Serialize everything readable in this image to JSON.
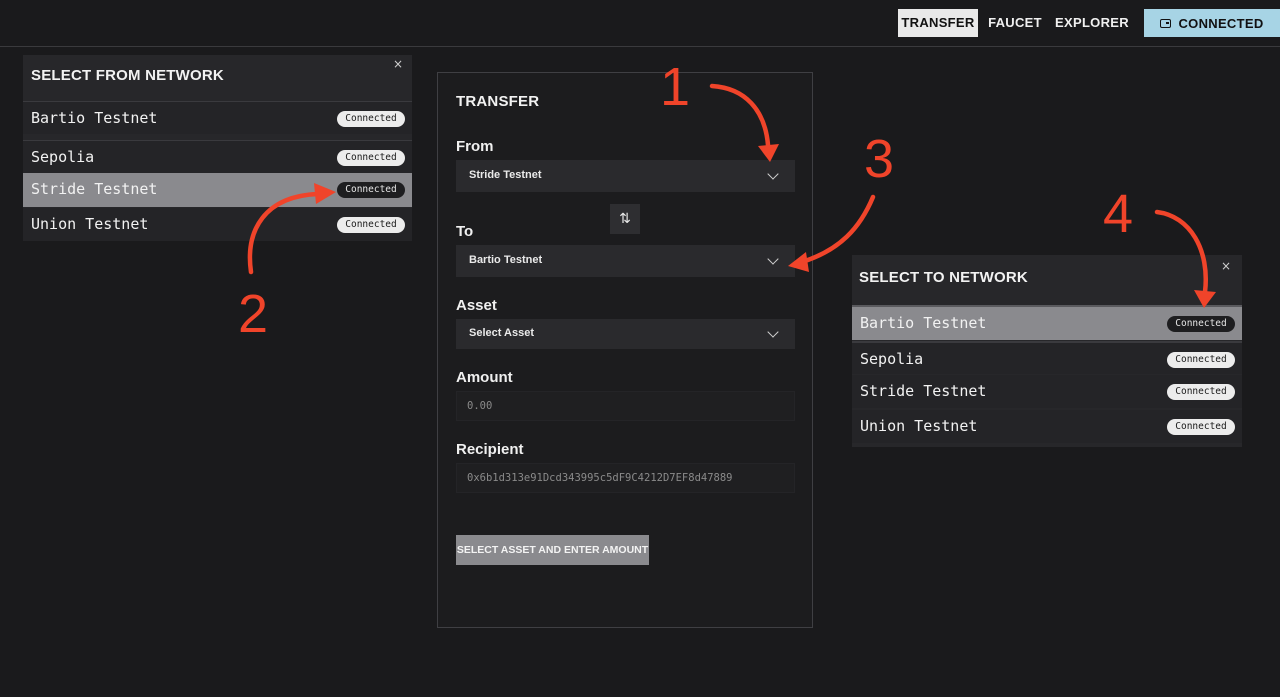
{
  "nav": {
    "transfer": "TRANSFER",
    "faucet": "FAUCET",
    "explorer": "EXPLORER",
    "connected": "CONNECTED"
  },
  "from_panel": {
    "title": "SELECT FROM NETWORK",
    "close": "×",
    "networks": [
      {
        "name": "Bartio Testnet",
        "status": "Connected"
      },
      {
        "name": "Sepolia",
        "status": "Connected"
      },
      {
        "name": "Stride Testnet",
        "status": "Connected"
      },
      {
        "name": "Union Testnet",
        "status": "Connected"
      }
    ]
  },
  "to_panel": {
    "title": "SELECT TO NETWORK",
    "close": "×",
    "networks": [
      {
        "name": "Bartio Testnet",
        "status": "Connected"
      },
      {
        "name": "Sepolia",
        "status": "Connected"
      },
      {
        "name": "Stride Testnet",
        "status": "Connected"
      },
      {
        "name": "Union Testnet",
        "status": "Connected"
      }
    ]
  },
  "transfer": {
    "title": "TRANSFER",
    "from_label": "From",
    "from_value": "Stride Testnet",
    "swap_icon": "⇅",
    "to_label": "To",
    "to_value": "Bartio Testnet",
    "asset_label": "Asset",
    "asset_value": "Select Asset",
    "amount_label": "Amount",
    "amount_placeholder": "0.00",
    "recipient_label": "Recipient",
    "recipient_value": "0x6b1d313e91Dcd343995c5dF9C4212D7EF8d47889",
    "submit_label": "SELECT ASSET AND ENTER AMOUNT"
  },
  "annotations": [
    "1",
    "2",
    "3",
    "4"
  ],
  "colors": {
    "background": "#1a1a1c",
    "connected_button": "#a7d4e5",
    "annotation": "#f0442a",
    "selected_row": "#8a8a8e"
  }
}
